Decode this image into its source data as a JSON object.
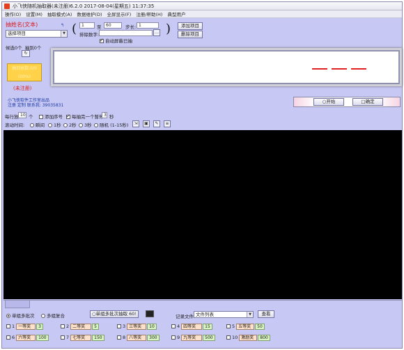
{
  "title": "小飞侠随机抽取器(未注册)6.2.0  2017-08-04(星期五) 11:37:35",
  "menu": [
    "操作(O)",
    "设置(M)",
    "抽取模式(A)",
    "数据维护(D)",
    "全屏显示(F)",
    "注册/帮助(H)",
    "典型用户"
  ],
  "left": {
    "heading": "抽姓名(文本)",
    "select_value": "选择项目",
    "candidate_label": "候选0个",
    "drawn_label": "抽到0个",
    "count_box_line1": "抽到总数:0/0",
    "count_box_line2": "(00%)",
    "unregistered": "(未注册)",
    "studio": "小飞侠软件工作室出品",
    "contact": "注册 定制 联系我:  39035831"
  },
  "range": {
    "from": "1",
    "to_label": "至",
    "to": "60",
    "step_label": "步长:",
    "step": "1",
    "exclude_label": "排除数字:",
    "exclude": "",
    "auto_mask_label": "自动屏蔽已抽"
  },
  "buttons": {
    "add_project": "添加项目",
    "delete_project": "删除项目",
    "start": "○开始",
    "confirm": "□确定",
    "single_group": "○单组多批次抽取 60!",
    "view": "查看"
  },
  "display_dashes": [
    "—",
    "—",
    "—"
  ],
  "options": {
    "per_row_label": "每行放",
    "per_row": "10",
    "per_row_unit": "个",
    "add_serial": "添加序号",
    "pause_label": "每抽完一个暂停",
    "pause_value": "3",
    "pause_unit": "秒",
    "scroll_label": "滚动时间:",
    "scroll_opts": [
      "瞬间",
      "1秒",
      "2秒",
      "3秒",
      "随机 (1-15秒)"
    ]
  },
  "bottom": {
    "mode_single": "单组多批次",
    "mode_multi": "多组复合",
    "record_label": "记录文件:",
    "record_value": "文件列表"
  },
  "prizes_row1": [
    {
      "num": "1",
      "name": "一等奖",
      "count": "3"
    },
    {
      "num": "2",
      "name": "二等奖",
      "count": "5"
    },
    {
      "num": "3",
      "name": "三等奖",
      "count": "10"
    },
    {
      "num": "4",
      "name": "四等奖",
      "count": "15"
    },
    {
      "num": "5",
      "name": "五等奖",
      "count": "50"
    }
  ],
  "prizes_row2": [
    {
      "num": "6",
      "name": "六等奖",
      "count": "100"
    },
    {
      "num": "7",
      "name": "七等奖",
      "count": "150"
    },
    {
      "num": "8",
      "name": "八等奖",
      "count": "300"
    },
    {
      "num": "9",
      "name": "九等奖",
      "count": "500"
    },
    {
      "num": "10",
      "name": "激励奖",
      "count": "800"
    }
  ]
}
